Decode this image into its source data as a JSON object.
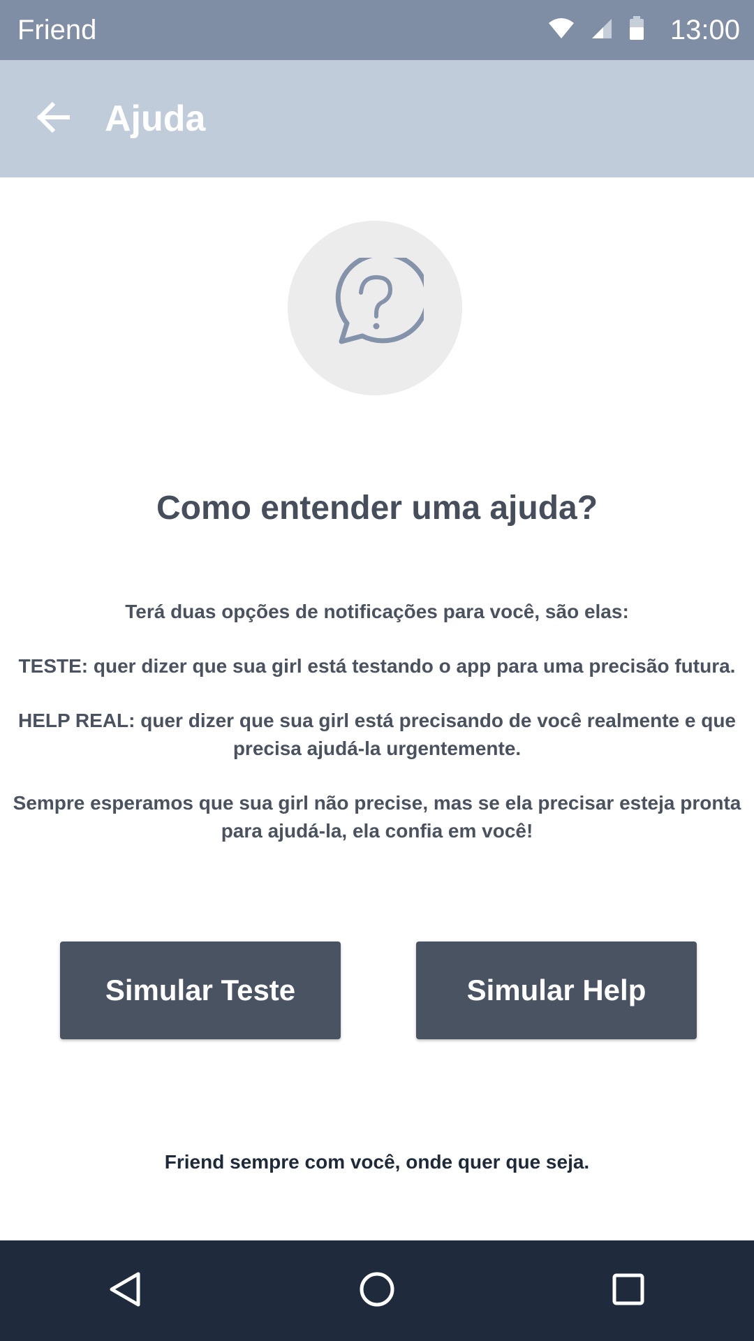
{
  "status_bar": {
    "app_name": "Friend",
    "time": "13:00",
    "icons": [
      "wifi-icon",
      "signal-icon",
      "battery-icon"
    ]
  },
  "app_bar": {
    "title": "Ajuda",
    "back_icon": "arrow-back-icon"
  },
  "content": {
    "hero_icon": "help-chat-bubble-icon",
    "title": "Como entender uma ajuda?",
    "paragraphs": [
      "Terá duas opções de notificações para você, são elas:",
      "TESTE: quer dizer que sua girl está testando o app para uma precisão futura.",
      "HELP REAL: quer dizer que sua girl está precisando de você realmente e que precisa ajudá-la urgentemente.",
      "Sempre esperamos que sua girl não precise, mas se ela precisar esteja pronta para ajudá-la, ela confia em você!"
    ],
    "buttons": {
      "simulate_test": "Simular Teste",
      "simulate_help": "Simular Help"
    },
    "footer": "Friend sempre com você, onde quer que seja."
  },
  "nav_bar": {
    "icons": [
      "back-triangle-icon",
      "home-circle-icon",
      "recents-square-icon"
    ]
  },
  "colors": {
    "status_bar": "#808ea5",
    "app_bar": "#c0ccda",
    "button": "#4a5361",
    "nav_bar": "#1f2b3c",
    "icon_gray": "#8593aa"
  }
}
